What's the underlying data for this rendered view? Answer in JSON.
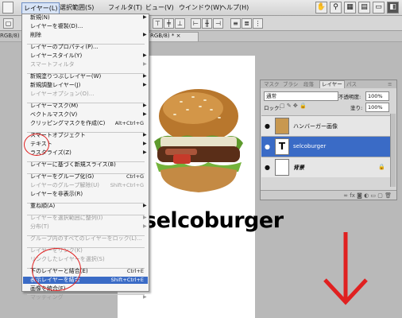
{
  "menubar": {
    "items": [
      "レイヤー(L)",
      "選択範囲(S)",
      "フィルタ(T)",
      "ビュー(V)",
      "ウインドウ(W)",
      "ヘルプ(H)"
    ]
  },
  "tabs": {
    "left_fragment": "RGB/8)",
    "doc_tab": "RGB/8) *  ×"
  },
  "document": {
    "brand_text": "selcoburger"
  },
  "layer_menu": {
    "items": [
      {
        "label": "新規(N)",
        "shortcut": "",
        "arrow": true,
        "disabled": false
      },
      {
        "label": "レイヤーを複製(D)...",
        "shortcut": "",
        "arrow": false,
        "disabled": false
      },
      {
        "label": "削除",
        "shortcut": "",
        "arrow": true,
        "disabled": false
      },
      {
        "label": "レイヤーのプロパティ(P)...",
        "shortcut": "",
        "arrow": false,
        "disabled": false
      },
      {
        "label": "レイヤースタイル(Y)",
        "shortcut": "",
        "arrow": true,
        "disabled": false
      },
      {
        "label": "スマートフィルタ",
        "shortcut": "",
        "arrow": true,
        "disabled": true
      },
      {
        "label": "新規塗りつぶしレイヤー(W)",
        "shortcut": "",
        "arrow": true,
        "disabled": false
      },
      {
        "label": "新規調整レイヤー(J)",
        "shortcut": "",
        "arrow": true,
        "disabled": false
      },
      {
        "label": "レイヤーオプション(O)...",
        "shortcut": "",
        "arrow": false,
        "disabled": true
      },
      {
        "label": "レイヤーマスク(M)",
        "shortcut": "",
        "arrow": true,
        "disabled": false
      },
      {
        "label": "ベクトルマスク(V)",
        "shortcut": "",
        "arrow": true,
        "disabled": false
      },
      {
        "label": "クリッピングマスクを作成(C)",
        "shortcut": "Alt+Ctrl+G",
        "arrow": false,
        "disabled": false
      },
      {
        "label": "スマートオブジェクト",
        "shortcut": "",
        "arrow": true,
        "disabled": false
      },
      {
        "label": "テキスト",
        "shortcut": "",
        "arrow": true,
        "disabled": false
      },
      {
        "label": "ラスタライズ(Z)",
        "shortcut": "",
        "arrow": true,
        "disabled": false
      },
      {
        "label": "レイヤーに基づく新規スライス(B)",
        "shortcut": "",
        "arrow": false,
        "disabled": false
      },
      {
        "label": "レイヤーをグループ化(G)",
        "shortcut": "Ctrl+G",
        "arrow": false,
        "disabled": false
      },
      {
        "label": "レイヤーのグループ解除(U)",
        "shortcut": "Shift+Ctrl+G",
        "arrow": false,
        "disabled": true
      },
      {
        "label": "レイヤーを非表示(R)",
        "shortcut": "",
        "arrow": false,
        "disabled": false
      },
      {
        "label": "重ね順(A)",
        "shortcut": "",
        "arrow": true,
        "disabled": false
      },
      {
        "label": "レイヤーを選択範囲に整列(I)",
        "shortcut": "",
        "arrow": true,
        "disabled": true
      },
      {
        "label": "分布(T)",
        "shortcut": "",
        "arrow": true,
        "disabled": true
      },
      {
        "label": "グループ内のすべてのレイヤーをロック(L)...",
        "shortcut": "",
        "arrow": false,
        "disabled": true
      },
      {
        "label": "レイヤーをリンク(K)",
        "shortcut": "",
        "arrow": false,
        "disabled": true
      },
      {
        "label": "リンクしたレイヤーを選択(S)",
        "shortcut": "",
        "arrow": false,
        "disabled": true
      },
      {
        "label": "下のレイヤーと結合(E)",
        "shortcut": "Ctrl+E",
        "arrow": false,
        "disabled": false
      },
      {
        "label": "表示レイヤーを結合",
        "shortcut": "Shift+Ctrl+E",
        "arrow": false,
        "disabled": false,
        "highlighted": true
      },
      {
        "label": "画像を統合(F)",
        "shortcut": "",
        "arrow": false,
        "disabled": false
      },
      {
        "label": "マッティング",
        "shortcut": "",
        "arrow": true,
        "disabled": true
      }
    ]
  },
  "layers_panel": {
    "tabs": [
      "マスク",
      "ブラシ",
      "段落",
      "レイヤー",
      "パス"
    ],
    "blend_mode": "通常",
    "opacity_label": "不透明度:",
    "opacity_value": "100%",
    "lock_label": "ロック:",
    "fill_label": "塗り:",
    "fill_value": "100%",
    "layers": [
      {
        "name": "ハンバーガー画像",
        "selected": false
      },
      {
        "name": "selcoburger",
        "selected": true
      },
      {
        "name": "背景",
        "selected": false
      }
    ]
  },
  "colors": {
    "highlight": "#3a6bc6",
    "annotation_red": "#e02020"
  }
}
